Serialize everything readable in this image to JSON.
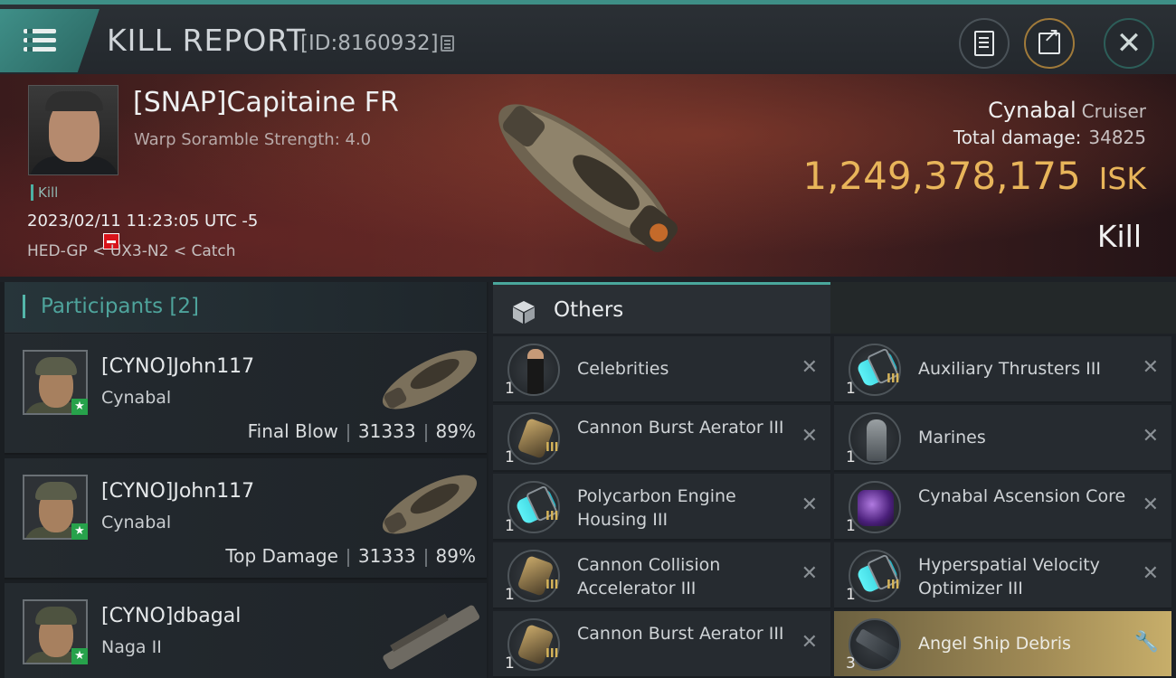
{
  "header": {
    "title": "KILL REPORT",
    "report_id": "[ID:8160932]"
  },
  "victim": {
    "name": "[SNAP]Capitaine FR",
    "warp_scramble": "Warp Soramble Strength: 4.0",
    "tag": "Kill",
    "timestamp": "2023/02/11 11:23:05 UTC -5",
    "location": "HED-GP < UX3-N2 < Catch",
    "ship_name": "Cynabal",
    "ship_class": "Cruiser",
    "total_damage_label": "Total damage:",
    "total_damage": "34825",
    "isk_value": "1,249,378,175",
    "isk_unit": "ISK",
    "result": "Kill"
  },
  "participants": {
    "title": "Participants [2]",
    "rows": [
      {
        "name": "[CYNO]John117",
        "ship": "Cynabal",
        "role": "Final Blow",
        "damage": "31333",
        "percent": "89%"
      },
      {
        "name": "[CYNO]John117",
        "ship": "Cynabal",
        "role": "Top Damage",
        "damage": "31333",
        "percent": "89%"
      },
      {
        "name": "[CYNO]dbagal",
        "ship": "Naga II",
        "role": "",
        "damage": "",
        "percent": ""
      }
    ]
  },
  "others": {
    "tab_label": "Others",
    "left_items": [
      {
        "name": "Celebrities",
        "qty": "1",
        "tier": "",
        "icon": "person-icon"
      },
      {
        "name": "Cannon Burst Aerator III",
        "qty": "1",
        "tier": "III",
        "icon": "cannon-module-icon"
      },
      {
        "name": "Polycarbon Engine Housing III",
        "qty": "1",
        "tier": "III",
        "icon": "engine-module-icon"
      },
      {
        "name": "Cannon Collision Accelerator III",
        "qty": "1",
        "tier": "III",
        "icon": "cannon-module-icon"
      },
      {
        "name": "Cannon Burst Aerator III",
        "qty": "1",
        "tier": "III",
        "icon": "cannon-module-icon"
      }
    ],
    "right_items": [
      {
        "name": "Auxiliary Thrusters III",
        "qty": "1",
        "tier": "III",
        "icon": "thruster-module-icon"
      },
      {
        "name": "Marines",
        "qty": "1",
        "tier": "",
        "icon": "marine-icon"
      },
      {
        "name": "Cynabal Ascension Core",
        "qty": "1",
        "tier": "",
        "icon": "core-icon"
      },
      {
        "name": "Hyperspatial Velocity Optimizer III",
        "qty": "1",
        "tier": "III",
        "icon": "thruster-module-icon"
      },
      {
        "name": "Angel Ship Debris",
        "qty": "3",
        "tier": "",
        "icon": "debris-icon"
      }
    ]
  },
  "colors": {
    "accent_teal": "#3e8f86",
    "isk_gold": "#e8b55a",
    "highlight_gold": "#c7ae6a"
  }
}
